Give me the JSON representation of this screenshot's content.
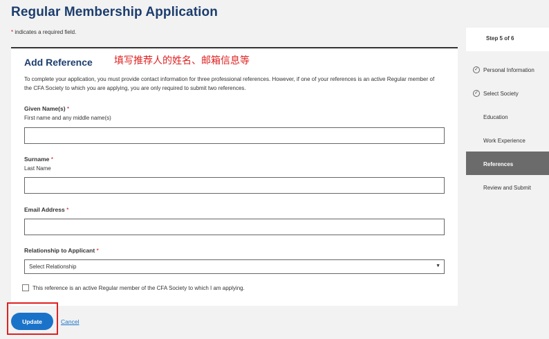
{
  "page": {
    "title": "Regular Membership Application",
    "required_note": "indicates a required field."
  },
  "form": {
    "section_title": "Add Reference",
    "annotation": "填写推荐人的姓名、邮箱信息等",
    "intro": "To complete your application, you must provide contact information for three professional references. However, if one of your references is an active Regular member of the CFA Society to which you are applying, you are only required to submit two references.",
    "given_name": {
      "label": "Given Name(s)",
      "hint": "First name and any middle name(s)",
      "value": ""
    },
    "surname": {
      "label": "Surname",
      "hint": "Last Name",
      "value": ""
    },
    "email": {
      "label": "Email Address",
      "value": ""
    },
    "relationship": {
      "label": "Relationship to Applicant",
      "selected": "Select Relationship"
    },
    "checkbox_label": "This reference is an active Regular member of the CFA Society to which I am applying.",
    "checkbox_checked": false
  },
  "actions": {
    "update_label": "Update",
    "cancel_label": "Cancel"
  },
  "steps": {
    "header": "Step 5 of 6",
    "items": [
      {
        "label": "Personal Information",
        "status": "complete"
      },
      {
        "label": "Select Society",
        "status": "complete"
      },
      {
        "label": "Education",
        "status": "pending"
      },
      {
        "label": "Work Experience",
        "status": "pending"
      },
      {
        "label": "References",
        "status": "active"
      },
      {
        "label": "Review and Submit",
        "status": "pending"
      }
    ]
  },
  "colors": {
    "title": "#1c3d6e",
    "accent": "#1a73c9",
    "required": "#c8102e",
    "annotation": "#e02020",
    "active_step": "#6b6b6b"
  }
}
